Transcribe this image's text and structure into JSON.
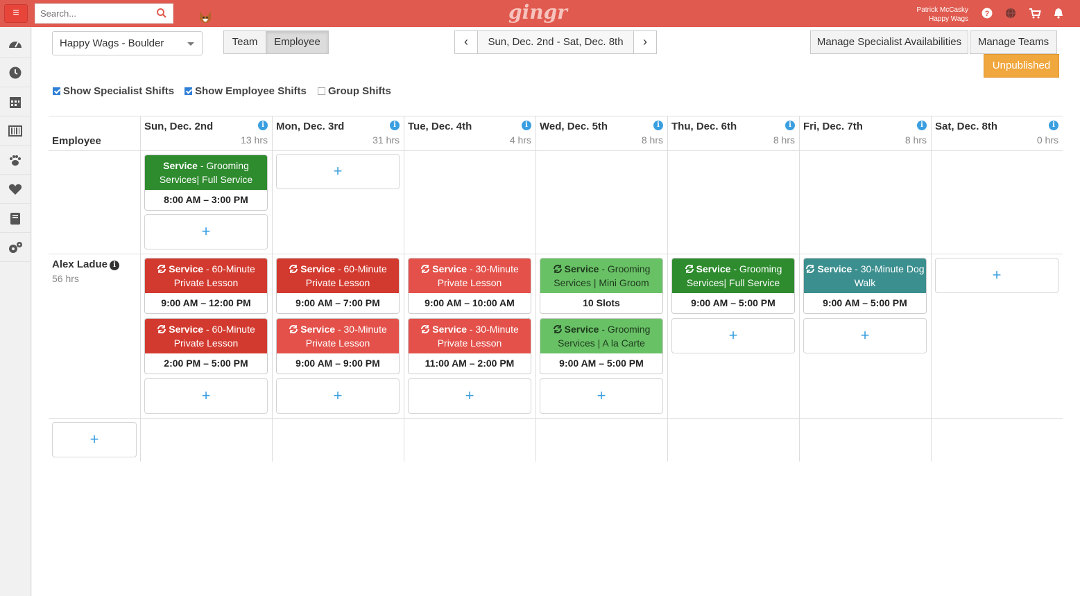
{
  "header": {
    "menu_label": "≡",
    "search_placeholder": "Search...",
    "logo": "gingr",
    "user_name": "Patrick McCasky",
    "user_company": "Happy Wags",
    "icons": [
      "help-icon",
      "globe-icon",
      "cart-icon",
      "bell-icon"
    ]
  },
  "sidebar": {
    "items": [
      "dashboard-icon",
      "clock-icon",
      "calendar-icon",
      "barcode-icon",
      "paw-icon",
      "heart-icon",
      "book-icon",
      "gears-icon"
    ]
  },
  "toolbar": {
    "location": "Happy Wags - Boulder",
    "team_label": "Team",
    "employee_label": "Employee",
    "date_range": "Sun, Dec. 2nd - Sat, Dec. 8th",
    "prev": "‹",
    "next": "›",
    "manage_avail_label": "Manage Specialist Availabilities",
    "manage_teams_label": "Manage Teams",
    "unpublished_label": "Unpublished"
  },
  "filters": {
    "specialist": "Show Specialist Shifts",
    "employee": "Show Employee Shifts",
    "group": "Group Shifts"
  },
  "grid": {
    "employee_header": "Employee",
    "days": [
      {
        "name": "Sun, Dec. 2nd",
        "hrs": "13 hrs"
      },
      {
        "name": "Mon, Dec. 3rd",
        "hrs": "31 hrs"
      },
      {
        "name": "Tue, Dec. 4th",
        "hrs": "4 hrs"
      },
      {
        "name": "Wed, Dec. 5th",
        "hrs": "8 hrs"
      },
      {
        "name": "Thu, Dec. 6th",
        "hrs": "8 hrs"
      },
      {
        "name": "Fri, Dec. 7th",
        "hrs": "8 hrs"
      },
      {
        "name": "Sat, Dec. 8th",
        "hrs": "0 hrs"
      }
    ],
    "employee": {
      "name": "Alex Ladue",
      "hrs": "56 hrs"
    },
    "add_label": "+",
    "unassigned": {
      "sun": {
        "title": "Service",
        "desc": " - Grooming Services| Full Service",
        "time": "8:00 AM – 3:00 PM"
      }
    },
    "alex": {
      "sun1": {
        "title": "Service",
        "desc": " - 60-Minute Private Lesson",
        "time": "9:00 AM – 12:00 PM"
      },
      "sun2": {
        "title": "Service",
        "desc": " - 60-Minute Private Lesson",
        "time": "2:00 PM – 5:00 PM"
      },
      "mon1": {
        "title": "Service",
        "desc": " - 60-Minute Private Lesson",
        "time": "9:00 AM – 7:00 PM"
      },
      "mon2": {
        "title": "Service",
        "desc": " - 30-Minute Private Lesson",
        "time": "9:00 AM – 9:00 PM"
      },
      "tue1": {
        "title": "Service",
        "desc": " - 30-Minute Private Lesson",
        "time": "9:00 AM – 10:00 AM"
      },
      "tue2": {
        "title": "Service",
        "desc": " - 30-Minute Private Lesson",
        "time": "11:00 AM – 2:00 PM"
      },
      "wed1": {
        "title": "Service",
        "desc": " - Grooming Services | Mini Groom",
        "time": "10 Slots"
      },
      "wed2": {
        "title": "Service",
        "desc": " - Grooming Services | A la Carte",
        "time": "9:00 AM – 5:00 PM"
      },
      "thu1": {
        "title": "Service",
        "desc": " - Grooming Services| Full Service",
        "time": "9:00 AM – 5:00 PM"
      },
      "fri1": {
        "title": "Service",
        "desc": " - 30-Minute Dog Walk",
        "time": "9:00 AM – 5:00 PM"
      }
    }
  },
  "colors": {
    "topbar": "#e05a4f",
    "red": "#d33a2f",
    "light_red": "#e3514a",
    "green": "#2e8b2e",
    "light_green": "#69c166",
    "teal": "#3c8f8f",
    "unpublished": "#f0a73e",
    "accent_blue": "#3a9fe0"
  }
}
